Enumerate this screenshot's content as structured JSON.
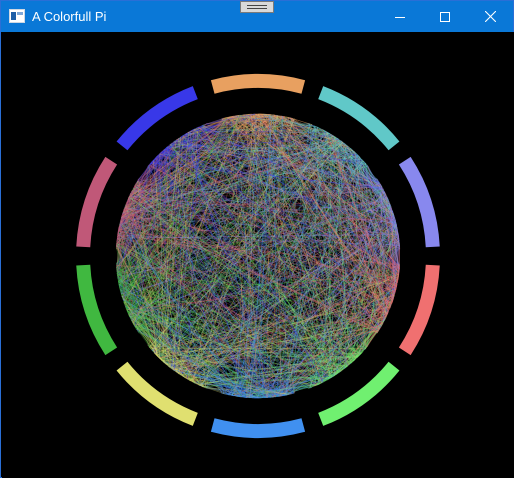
{
  "window": {
    "title": "A Colorfull Pi",
    "controls": {
      "minimize_icon": "minimize-icon",
      "maximize_icon": "maximize-icon",
      "close_icon": "close-icon"
    },
    "colors": {
      "titlebar": "#0a78d7",
      "canvas_background": "#000000"
    }
  },
  "visualization": {
    "ring_segments": [
      {
        "color": "#e8a060"
      },
      {
        "color": "#60c8c8"
      },
      {
        "color": "#8888ee"
      },
      {
        "color": "#f07070"
      },
      {
        "color": "#70f070"
      },
      {
        "color": "#4090f0"
      },
      {
        "color": "#e0e070"
      },
      {
        "color": "#40b840"
      },
      {
        "color": "#c05878"
      },
      {
        "color": "#3838e8"
      }
    ],
    "digit_count": 10
  }
}
